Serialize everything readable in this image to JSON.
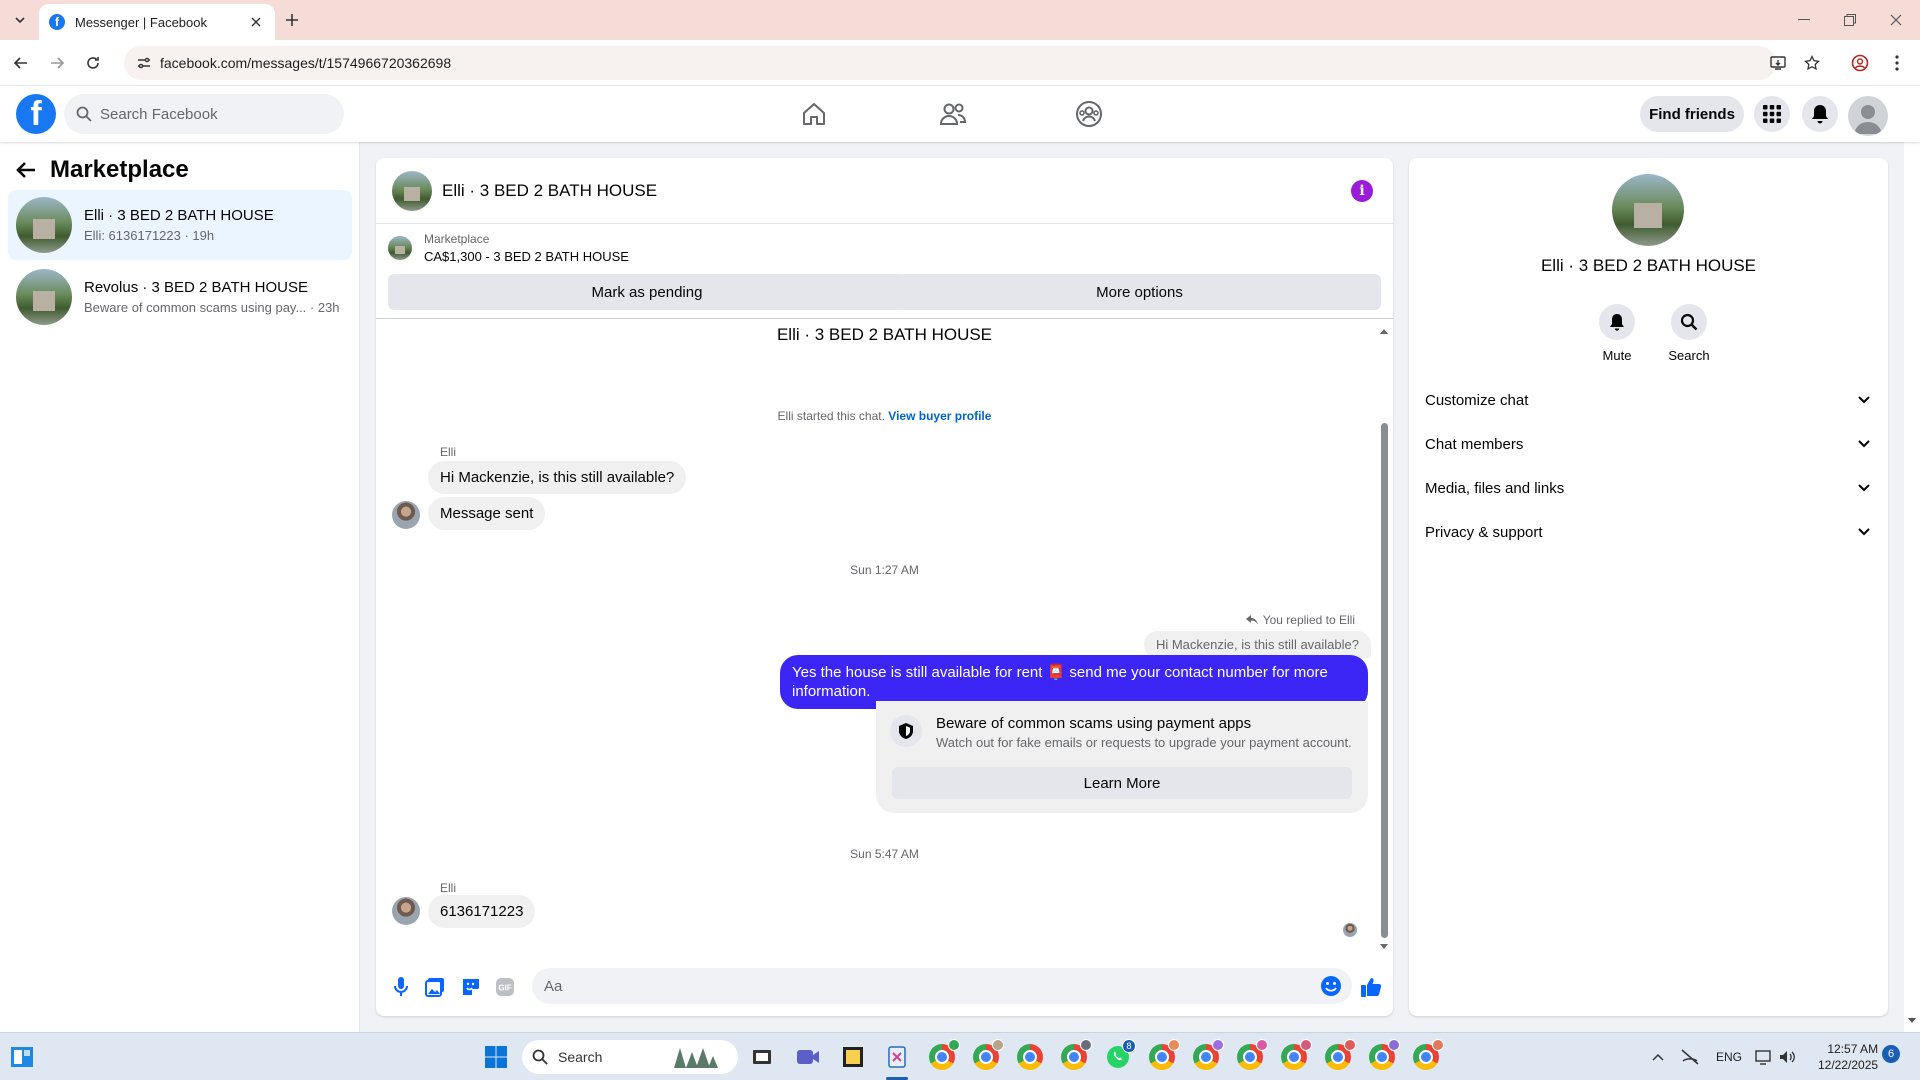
{
  "browser": {
    "tab_title": "Messenger | Facebook",
    "url": "facebook.com/messages/t/1574966720362698"
  },
  "fb": {
    "search_placeholder": "Search Facebook",
    "find_friends": "Find friends"
  },
  "left": {
    "title": "Marketplace",
    "conversations": [
      {
        "name": "Elli · 3 BED 2 BATH HOUSE",
        "preview": "Elli: 6136171223 · 19h"
      },
      {
        "name": "Revolus · 3 BED 2 BATH HOUSE",
        "preview": "Beware of common scams using pay... · 23h"
      }
    ]
  },
  "chat": {
    "title": "Elli · 3 BED 2 BATH HOUSE",
    "listing_label": "Marketplace",
    "listing_detail": "CA$1,300 - 3 BED 2 BATH HOUSE",
    "mark_pending": "Mark as pending",
    "more_options": "More options",
    "thread_title": "Elli · 3 BED 2 BATH HOUSE",
    "started_text": "Elli started this chat.",
    "view_profile": "View buyer profile",
    "sender_1": "Elli",
    "msg_1": "Hi Mackenzie, is this still available?",
    "msg_2": "Message sent",
    "time_1": "Sun 1:27 AM",
    "replied_to": "You replied to Elli",
    "quoted": "Hi Mackenzie, is this still available?",
    "reply_line1": "Yes the house is still available for rent 📮 send me your contact number for more",
    "reply_line2": "information.",
    "scam_title": "Beware of common scams using payment apps",
    "scam_sub": "Watch out for fake emails or requests to upgrade your payment account.",
    "learn_more": "Learn More",
    "time_2": "Sun 5:47 AM",
    "sender_2": "Elli",
    "msg_3": "6136171223",
    "input_placeholder": "Aa"
  },
  "right": {
    "name": "Elli · 3 BED 2 BATH HOUSE",
    "mute": "Mute",
    "search": "Search",
    "rows": [
      "Customize chat",
      "Chat members",
      "Media, files and links",
      "Privacy & support"
    ]
  },
  "taskbar": {
    "search": "Search",
    "lang": "ENG",
    "time": "12:57 AM",
    "date": "12/22/2025",
    "notif_count": "6",
    "whatsapp_badge": "8"
  },
  "colors": {
    "fb_blue": "#1877f2",
    "outgoing_bubble": "#3b26f5",
    "info_purple": "#9a1bd8"
  }
}
